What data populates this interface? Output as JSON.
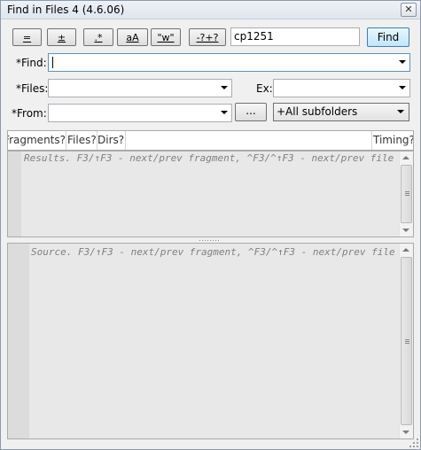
{
  "window": {
    "title": "Find in Files 4 (4.6.06)",
    "close_label": "✕"
  },
  "toolbar": {
    "buttons": [
      {
        "label": "=",
        "name": "exact-match-button"
      },
      {
        "label": "±",
        "name": "plus-minus-button"
      },
      {
        "label": ".*",
        "name": "regex-button"
      },
      {
        "label": "aA",
        "name": "case-sensitive-button"
      },
      {
        "label": "\"w\"",
        "name": "whole-words-button"
      },
      {
        "label": "-?+?",
        "name": "wildcards-button"
      }
    ],
    "encoding_value": "cp1251",
    "find_label": "Find"
  },
  "find": {
    "label": "*Find:",
    "value": ""
  },
  "files": {
    "label": "*Files:",
    "value": "",
    "ex_label": "Ex:",
    "ex_value": ""
  },
  "from": {
    "label": "*From:",
    "value": "",
    "browse_label": "...",
    "subfolders_value": "+All subfolders"
  },
  "results": {
    "columns": [
      "Fragments?",
      "Files?",
      "Dirs?",
      "Timing?"
    ],
    "placeholder": "Results. F3/↑F3 - next/prev fragment, ^F3/^↑F3 - next/prev file"
  },
  "source": {
    "placeholder": "Source. F3/↑F3 - next/prev fragment, ^F3/^↑F3 - next/prev file"
  }
}
